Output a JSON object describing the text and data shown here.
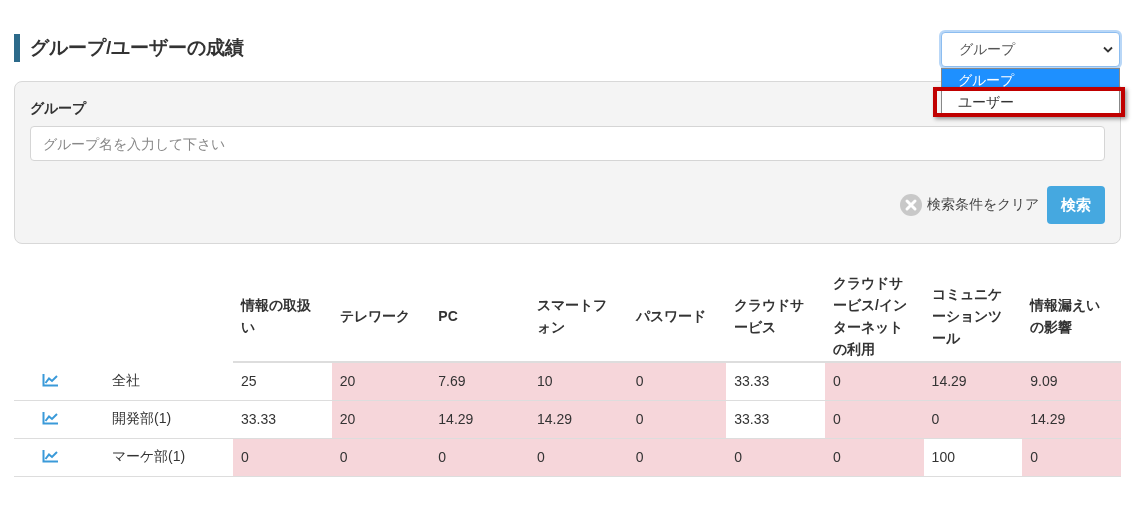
{
  "title": "グループ/ユーザーの成績",
  "mode_select": {
    "value": "グループ",
    "expanded": true,
    "options": [
      {
        "label": "グループ",
        "selected": true,
        "annotated": false
      },
      {
        "label": "ユーザー",
        "selected": false,
        "annotated": true
      }
    ]
  },
  "search_panel": {
    "label": "グループ",
    "placeholder": "グループ名を入力して下さい",
    "clear_link": "検索条件をクリア",
    "search_button": "検索"
  },
  "table": {
    "columns": [
      "情報の取扱い",
      "テレワーク",
      "PC",
      "スマートフォン",
      "パスワード",
      "クラウドサービス",
      "クラウドサービス/インターネットの利用",
      "コミュニケーションツール",
      "情報漏えいの影響"
    ],
    "rows": [
      {
        "name": "全社",
        "cells": [
          {
            "value": "25",
            "low": false
          },
          {
            "value": "20",
            "low": true
          },
          {
            "value": "7.69",
            "low": true
          },
          {
            "value": "10",
            "low": true
          },
          {
            "value": "0",
            "low": true
          },
          {
            "value": "33.33",
            "low": false
          },
          {
            "value": "0",
            "low": true
          },
          {
            "value": "14.29",
            "low": true
          },
          {
            "value": "9.09",
            "low": true
          }
        ]
      },
      {
        "name": "開発部(1)",
        "cells": [
          {
            "value": "33.33",
            "low": false
          },
          {
            "value": "20",
            "low": true
          },
          {
            "value": "14.29",
            "low": true
          },
          {
            "value": "14.29",
            "low": true
          },
          {
            "value": "0",
            "low": true
          },
          {
            "value": "33.33",
            "low": false
          },
          {
            "value": "0",
            "low": true
          },
          {
            "value": "0",
            "low": true
          },
          {
            "value": "14.29",
            "low": true
          }
        ]
      },
      {
        "name": "マーケ部(1)",
        "cells": [
          {
            "value": "0",
            "low": true
          },
          {
            "value": "0",
            "low": true
          },
          {
            "value": "0",
            "low": true
          },
          {
            "value": "0",
            "low": true
          },
          {
            "value": "0",
            "low": true
          },
          {
            "value": "0",
            "low": true
          },
          {
            "value": "0",
            "low": true
          },
          {
            "value": "100",
            "low": false
          },
          {
            "value": "0",
            "low": true
          }
        ]
      }
    ]
  }
}
